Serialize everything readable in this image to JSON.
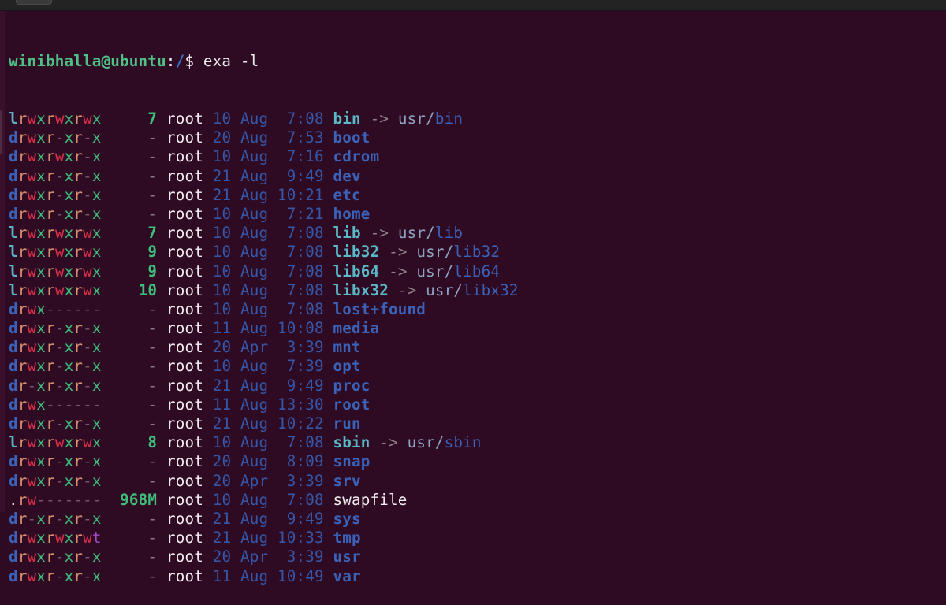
{
  "window": {
    "background": "#2f0a23",
    "topbar_color": "#222322"
  },
  "prompt": {
    "user_host": "winibhalla@ubuntu",
    "separator": ":",
    "path": "/",
    "symbol": "$",
    "command": "exa -l"
  },
  "colors": {
    "perm_r": "#d7906f",
    "perm_w": "#d8314a",
    "perm_x": "#3ebd7c",
    "perm_dash": "#6d5a66",
    "perm_t": "#a14cc9",
    "type_dir": "#3b62b8",
    "type_link": "#5bb2c4",
    "size": "#3ebd7c",
    "date": "#3557a8",
    "dir_name": "#3a62b8",
    "link_name": "#5bb8c6",
    "file_name": "#f1ecef"
  },
  "listing": [
    {
      "perms": "lrwxrwxrwx",
      "size": "7",
      "user": "root",
      "day": "10",
      "month": "Aug",
      "time": "7:08",
      "name": "bin",
      "kind": "link",
      "target_path": "usr/",
      "target_name": "bin"
    },
    {
      "perms": "drwxr-xr-x",
      "size": "-",
      "user": "root",
      "day": "20",
      "month": "Aug",
      "time": "7:53",
      "name": "boot",
      "kind": "dir"
    },
    {
      "perms": "drwxrwxr-x",
      "size": "-",
      "user": "root",
      "day": "10",
      "month": "Aug",
      "time": "7:16",
      "name": "cdrom",
      "kind": "dir"
    },
    {
      "perms": "drwxr-xr-x",
      "size": "-",
      "user": "root",
      "day": "21",
      "month": "Aug",
      "time": "9:49",
      "name": "dev",
      "kind": "dir"
    },
    {
      "perms": "drwxr-xr-x",
      "size": "-",
      "user": "root",
      "day": "21",
      "month": "Aug",
      "time": "10:21",
      "name": "etc",
      "kind": "dir"
    },
    {
      "perms": "drwxr-xr-x",
      "size": "-",
      "user": "root",
      "day": "10",
      "month": "Aug",
      "time": "7:21",
      "name": "home",
      "kind": "dir"
    },
    {
      "perms": "lrwxrwxrwx",
      "size": "7",
      "user": "root",
      "day": "10",
      "month": "Aug",
      "time": "7:08",
      "name": "lib",
      "kind": "link",
      "target_path": "usr/",
      "target_name": "lib"
    },
    {
      "perms": "lrwxrwxrwx",
      "size": "9",
      "user": "root",
      "day": "10",
      "month": "Aug",
      "time": "7:08",
      "name": "lib32",
      "kind": "link",
      "target_path": "usr/",
      "target_name": "lib32"
    },
    {
      "perms": "lrwxrwxrwx",
      "size": "9",
      "user": "root",
      "day": "10",
      "month": "Aug",
      "time": "7:08",
      "name": "lib64",
      "kind": "link",
      "target_path": "usr/",
      "target_name": "lib64"
    },
    {
      "perms": "lrwxrwxrwx",
      "size": "10",
      "user": "root",
      "day": "10",
      "month": "Aug",
      "time": "7:08",
      "name": "libx32",
      "kind": "link",
      "target_path": "usr/",
      "target_name": "libx32"
    },
    {
      "perms": "drwx------",
      "size": "-",
      "user": "root",
      "day": "10",
      "month": "Aug",
      "time": "7:08",
      "name": "lost+found",
      "kind": "dir"
    },
    {
      "perms": "drwxr-xr-x",
      "size": "-",
      "user": "root",
      "day": "11",
      "month": "Aug",
      "time": "10:08",
      "name": "media",
      "kind": "dir"
    },
    {
      "perms": "drwxr-xr-x",
      "size": "-",
      "user": "root",
      "day": "20",
      "month": "Apr",
      "time": "3:39",
      "name": "mnt",
      "kind": "dir"
    },
    {
      "perms": "drwxr-xr-x",
      "size": "-",
      "user": "root",
      "day": "10",
      "month": "Aug",
      "time": "7:39",
      "name": "opt",
      "kind": "dir"
    },
    {
      "perms": "dr-xr-xr-x",
      "size": "-",
      "user": "root",
      "day": "21",
      "month": "Aug",
      "time": "9:49",
      "name": "proc",
      "kind": "dir"
    },
    {
      "perms": "drwx------",
      "size": "-",
      "user": "root",
      "day": "11",
      "month": "Aug",
      "time": "13:30",
      "name": "root",
      "kind": "dir"
    },
    {
      "perms": "drwxr-xr-x",
      "size": "-",
      "user": "root",
      "day": "21",
      "month": "Aug",
      "time": "10:22",
      "name": "run",
      "kind": "dir"
    },
    {
      "perms": "lrwxrwxrwx",
      "size": "8",
      "user": "root",
      "day": "10",
      "month": "Aug",
      "time": "7:08",
      "name": "sbin",
      "kind": "link",
      "target_path": "usr/",
      "target_name": "sbin"
    },
    {
      "perms": "drwxr-xr-x",
      "size": "-",
      "user": "root",
      "day": "20",
      "month": "Aug",
      "time": "8:09",
      "name": "snap",
      "kind": "dir"
    },
    {
      "perms": "drwxr-xr-x",
      "size": "-",
      "user": "root",
      "day": "20",
      "month": "Apr",
      "time": "3:39",
      "name": "srv",
      "kind": "dir"
    },
    {
      "perms": ".rw-------",
      "size": "968M",
      "user": "root",
      "day": "10",
      "month": "Aug",
      "time": "7:08",
      "name": "swapfile",
      "kind": "file"
    },
    {
      "perms": "dr-xr-xr-x",
      "size": "-",
      "user": "root",
      "day": "21",
      "month": "Aug",
      "time": "9:49",
      "name": "sys",
      "kind": "dir"
    },
    {
      "perms": "drwxrwxrwt",
      "size": "-",
      "user": "root",
      "day": "21",
      "month": "Aug",
      "time": "10:33",
      "name": "tmp",
      "kind": "dir"
    },
    {
      "perms": "drwxr-xr-x",
      "size": "-",
      "user": "root",
      "day": "20",
      "month": "Apr",
      "time": "3:39",
      "name": "usr",
      "kind": "dir"
    },
    {
      "perms": "drwxr-xr-x",
      "size": "-",
      "user": "root",
      "day": "11",
      "month": "Aug",
      "time": "10:49",
      "name": "var",
      "kind": "dir"
    }
  ],
  "symlink_arrow": "->"
}
